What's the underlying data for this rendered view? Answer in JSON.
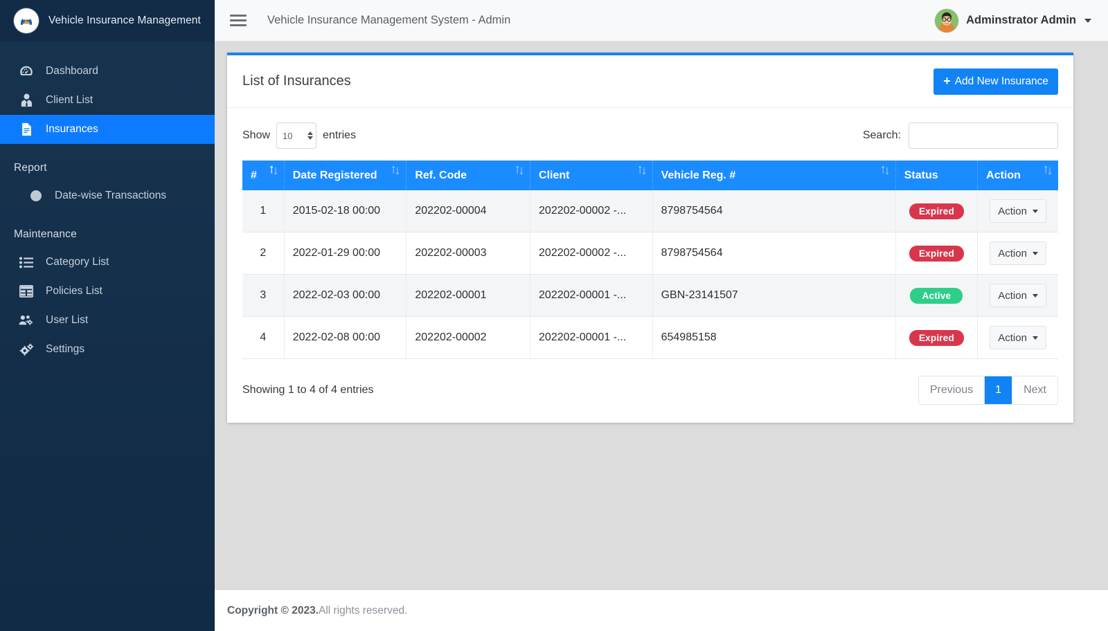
{
  "sidebar": {
    "brand": {
      "title": "Vehicle Insurance Management",
      "logo_icon": "car-shield-logo-icon"
    },
    "items": [
      {
        "label": "Dashboard",
        "icon": "tachometer-icon",
        "active": false
      },
      {
        "label": "Client List",
        "icon": "user-tie-icon",
        "active": false
      },
      {
        "label": "Insurances",
        "icon": "file-document-icon",
        "active": true
      }
    ],
    "report_heading": "Report",
    "report_items": [
      {
        "label": "Date-wise Transactions",
        "icon": "circle-dot-icon"
      }
    ],
    "maintenance_heading": "Maintenance",
    "maintenance_items": [
      {
        "label": "Category List",
        "icon": "list-ul-icon"
      },
      {
        "label": "Policies List",
        "icon": "table-grid-icon"
      },
      {
        "label": "User List",
        "icon": "users-cog-icon"
      },
      {
        "label": "Settings",
        "icon": "cogs-icon"
      }
    ]
  },
  "topbar": {
    "menu_icon": "hamburger-icon",
    "title": "Vehicle Insurance Management System - Admin",
    "user_name": "Adminstrator Admin",
    "avatar_icon": "user-avatar",
    "caret_icon": "caret-down-icon"
  },
  "card": {
    "title": "List of Insurances",
    "add_button": {
      "label": "Add New Insurance",
      "icon": "plus-icon"
    },
    "accent_color": "#1a82e8"
  },
  "controls": {
    "show_label": "Show",
    "entries_label": "entries",
    "page_length": "10",
    "search_label": "Search:",
    "search_value": "",
    "search_placeholder": ""
  },
  "table": {
    "columns": [
      {
        "label": "#",
        "sort": "asc"
      },
      {
        "label": "Date Registered",
        "sort": "none"
      },
      {
        "label": "Ref. Code",
        "sort": "none"
      },
      {
        "label": "Client",
        "sort": "none"
      },
      {
        "label": "Vehicle Reg. #",
        "sort": "none"
      },
      {
        "label": "Status",
        "sort": "none"
      },
      {
        "label": "Action",
        "sort": "none"
      }
    ],
    "rows": [
      {
        "num": "1",
        "date": "2015-02-18 00:00",
        "ref": "202202-00004",
        "client": "202202-00002 -...",
        "vehicle": "8798754564",
        "status": "Expired",
        "status_type": "expired",
        "action": "Action"
      },
      {
        "num": "2",
        "date": "2022-01-29 00:00",
        "ref": "202202-00003",
        "client": "202202-00002 -...",
        "vehicle": "8798754564",
        "status": "Expired",
        "status_type": "expired",
        "action": "Action"
      },
      {
        "num": "3",
        "date": "2022-02-03 00:00",
        "ref": "202202-00001",
        "client": "202202-00001 -...",
        "vehicle": "GBN-23141507",
        "status": "Active",
        "status_type": "active",
        "action": "Action"
      },
      {
        "num": "4",
        "date": "2022-02-08 00:00",
        "ref": "202202-00002",
        "client": "202202-00001 -...",
        "vehicle": "654985158",
        "status": "Expired",
        "status_type": "expired",
        "action": "Action"
      }
    ]
  },
  "pagination": {
    "info": "Showing 1 to 4 of 4 entries",
    "previous": "Previous",
    "pages": [
      "1"
    ],
    "current_page": "1",
    "next": "Next"
  },
  "footer": {
    "copyright_bold": "Copyright © 2023.",
    "copyright_rest": " All rights reserved."
  },
  "colors": {
    "sidebar_bg": "#14304f",
    "active_nav": "#0d7bff",
    "table_head": "#1a8cff",
    "primary": "#1283f5",
    "badge_expired": "#d9364c",
    "badge_active": "#2dce89",
    "page_bg": "#dcdcdc"
  }
}
